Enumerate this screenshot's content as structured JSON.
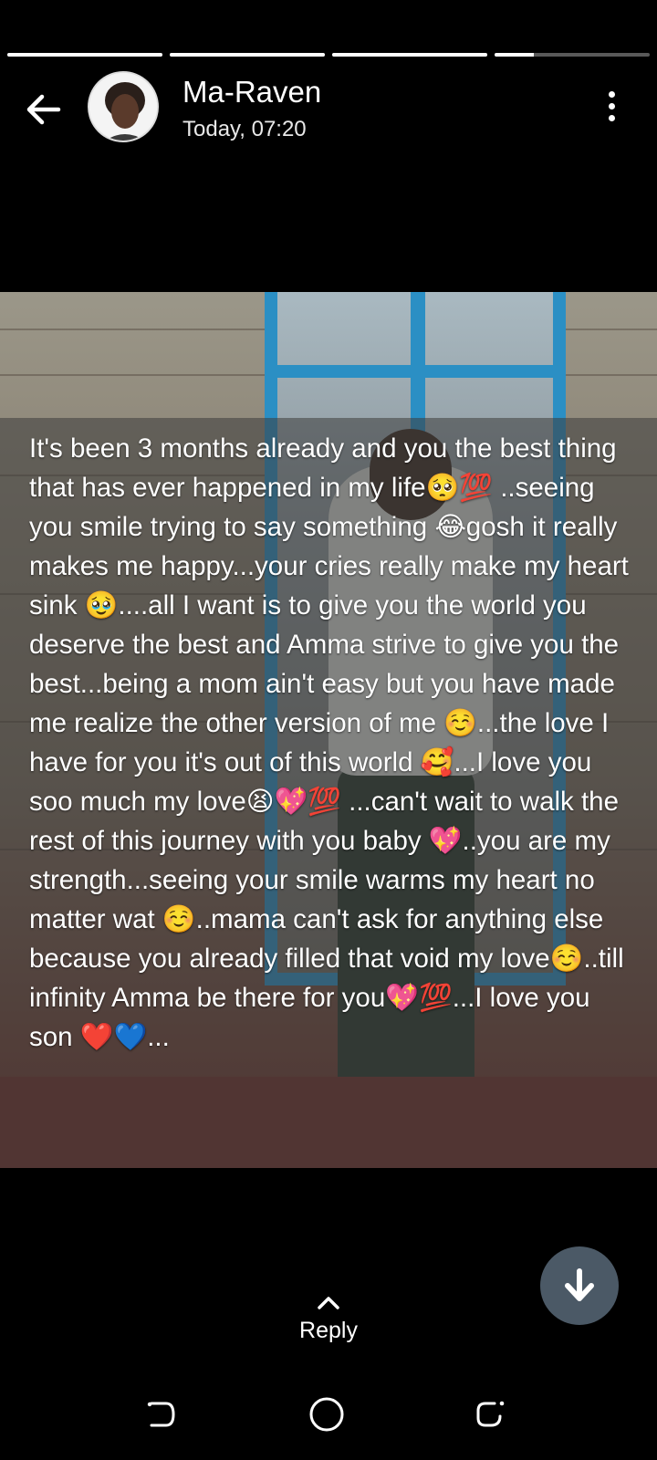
{
  "status": {
    "progress": [
      1.0,
      1.0,
      1.0,
      0.25
    ]
  },
  "header": {
    "name": "Ma-Raven",
    "time": "Today, 07:20",
    "back_icon": "arrow-left-icon",
    "menu_icon": "more-vertical-icon"
  },
  "story": {
    "caption": "It's been 3 months already and you the best thing that has ever happened in my life🥺💯 ..seeing you smile trying to say something 😂gosh it really makes me happy...your cries really make my heart sink 🥹....all I want is to give you the world you deserve the best and Amma strive to give you the best...being a mom ain't easy but you have made me realize the other version of me ☺️...the love I have for you it's out of this world 🥰...I love you soo much my love😫💖💯 ...can't wait to walk the rest of this journey with you baby 💖..you are my strength...seeing your smile warms my heart no matter wat ☺️..mama can't ask for anything else because you already filled that void my love☺️..till infinity Amma be there for you💖💯...I love you son ❤️💙..."
  },
  "footer": {
    "reply_label": "Reply",
    "scroll_icon": "arrow-down-icon"
  },
  "colors": {
    "background": "#000000",
    "fab": "#4b5966"
  }
}
